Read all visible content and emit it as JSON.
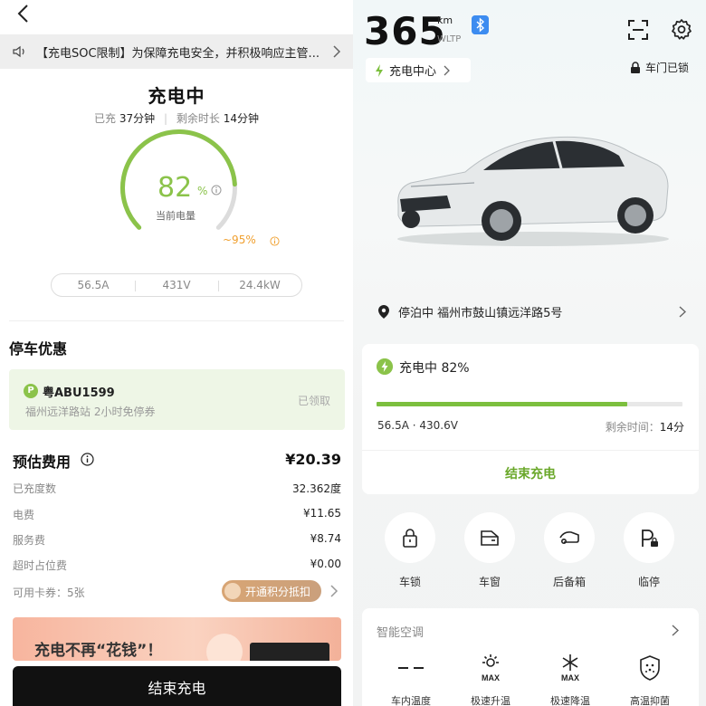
{
  "left": {
    "notice": "【充电SOC限制】为保障充电安全，并积极响应主管...",
    "title": "充电中",
    "charged_label": "已充",
    "charged_value": "37分钟",
    "remaining_label": "剩余时长",
    "remaining_value": "14分钟",
    "soc_value": "82",
    "soc_unit": "%",
    "soc_label": "当前电量",
    "soc_fraction": 0.82,
    "limit": "~95%",
    "stats": [
      "56.5A",
      "431V",
      "24.4kW"
    ],
    "parking_title": "停车优惠",
    "coupon": {
      "badge": "P",
      "plate": "粤ABU1599",
      "desc": "福州远洋路站 2小时免停券",
      "status": "已领取"
    },
    "fee": {
      "title": "预估费用",
      "total": "¥20.39",
      "rows": [
        {
          "label": "已充度数",
          "value": "32.362度"
        },
        {
          "label": "电费",
          "value": "¥11.65"
        },
        {
          "label": "服务费",
          "value": "¥8.74"
        },
        {
          "label": "超时占位费",
          "value": "¥0.00"
        }
      ],
      "cards": "可用卡券：5张",
      "redeem": "开通积分抵扣"
    },
    "banner": "充电不再“花钱”！",
    "end_button": "结束充电"
  },
  "right": {
    "range": "365",
    "range_unit": "km",
    "range_std": "WLTP",
    "charge_center": "充电中心",
    "lock_status": "车门已锁",
    "location": "停泊中  福州市鼓山镇远洋路5号",
    "charging": {
      "title": "充电中 82%",
      "progress": 0.82,
      "electric": "56.5A · 430.6V",
      "remaining_label": "剩余时间：",
      "remaining_value": "14分",
      "stop": "结束充电"
    },
    "controls": [
      {
        "label": "车锁",
        "icon": "lock-icon"
      },
      {
        "label": "车窗",
        "icon": "window-icon"
      },
      {
        "label": "后备箱",
        "icon": "trunk-icon"
      },
      {
        "label": "临停",
        "icon": "parking-lock-icon"
      }
    ],
    "ac": {
      "title": "智能空调",
      "items": [
        {
          "label": "车内温度",
          "icon": "temperature-icon"
        },
        {
          "label": "极速升温",
          "icon": "max-heat-icon"
        },
        {
          "label": "极速降温",
          "icon": "max-cool-icon"
        },
        {
          "label": "高温抑菌",
          "icon": "sterilize-icon"
        }
      ]
    }
  },
  "colors": {
    "accent_green": "#8bc34a",
    "progress_green": "#7cbf3e",
    "limit_orange": "#f0a030",
    "bluetooth_blue": "#3d8cf0"
  }
}
